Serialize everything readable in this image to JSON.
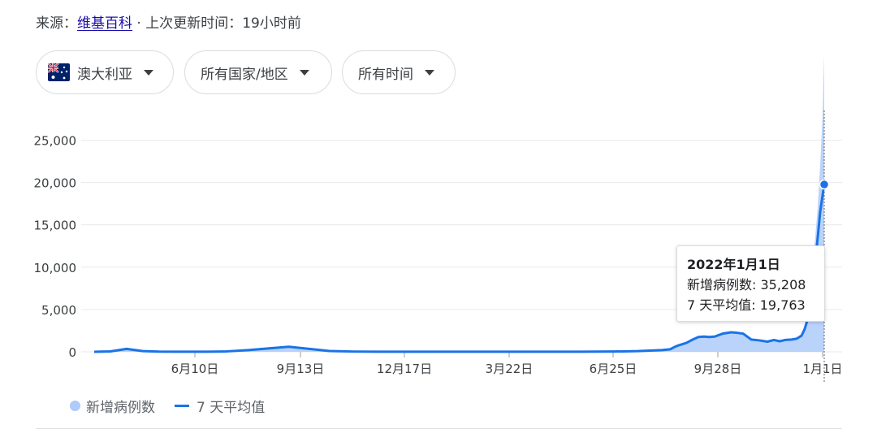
{
  "header": {
    "source_label": "来源：",
    "source_name": "维基百科",
    "update_text": " · 上次更新时间：19小时前"
  },
  "filters": [
    {
      "label": "澳大利亚",
      "icon": "australia-flag-icon"
    },
    {
      "label": "所有国家/地区"
    },
    {
      "label": "所有时间"
    }
  ],
  "tooltip": {
    "date": "2022年1月1日",
    "cases": "新增病例数: 35,208",
    "avg": "7 天平均值: 19,763"
  },
  "legend": {
    "cases": "新增病例数",
    "avg": "7 天平均值"
  },
  "colors": {
    "line": "#1a73e8",
    "area": "#aecbfa",
    "grid": "#e8eaed"
  },
  "chart_data": {
    "type": "line",
    "x_tick_labels": [
      "6月10日",
      "9月13日",
      "12月17日",
      "3月22日",
      "6月25日",
      "9月28日",
      "1月1日"
    ],
    "yticks": [
      0,
      5000,
      10000,
      15000,
      20000,
      25000
    ],
    "ytick_labels": [
      "0",
      "5,000",
      "10,000",
      "15,000",
      "20,000",
      "25,000"
    ],
    "ylim": [
      0,
      28500
    ],
    "x": [
      0,
      20,
      40,
      60,
      80,
      100,
      130,
      160,
      190,
      240,
      290,
      320,
      350,
      380,
      400,
      430,
      460,
      490,
      520,
      560,
      600,
      640,
      670,
      700,
      710,
      715,
      720,
      730,
      738,
      745,
      752,
      758,
      765,
      775,
      785,
      792,
      800,
      810,
      820,
      830,
      838,
      845,
      852,
      860,
      866,
      872,
      876,
      880,
      884,
      888,
      892,
      895,
      898,
      900
    ],
    "series": [
      {
        "name": "7 天平均值",
        "values": [
          0,
          50,
          350,
          80,
          20,
          10,
          10,
          30,
          200,
          600,
          100,
          30,
          10,
          10,
          10,
          10,
          10,
          10,
          10,
          10,
          10,
          30,
          80,
          200,
          300,
          550,
          750,
          1050,
          1450,
          1750,
          1800,
          1750,
          1800,
          2150,
          2300,
          2250,
          2150,
          1450,
          1350,
          1200,
          1400,
          1250,
          1400,
          1450,
          1550,
          1900,
          2700,
          4000,
          6200,
          9800,
          13500,
          16500,
          18500,
          19763
        ]
      },
      {
        "name": "新增病例数",
        "values": [
          0,
          60,
          380,
          90,
          25,
          12,
          12,
          35,
          220,
          650,
          110,
          35,
          12,
          12,
          12,
          12,
          12,
          12,
          12,
          12,
          12,
          35,
          90,
          230,
          330,
          600,
          800,
          1150,
          1550,
          1850,
          1900,
          1850,
          1950,
          2300,
          2450,
          2400,
          2250,
          1550,
          1450,
          1300,
          1500,
          1350,
          1500,
          1550,
          1700,
          2100,
          3200,
          5000,
          8000,
          12500,
          17000,
          22000,
          28000,
          35208
        ]
      }
    ]
  }
}
